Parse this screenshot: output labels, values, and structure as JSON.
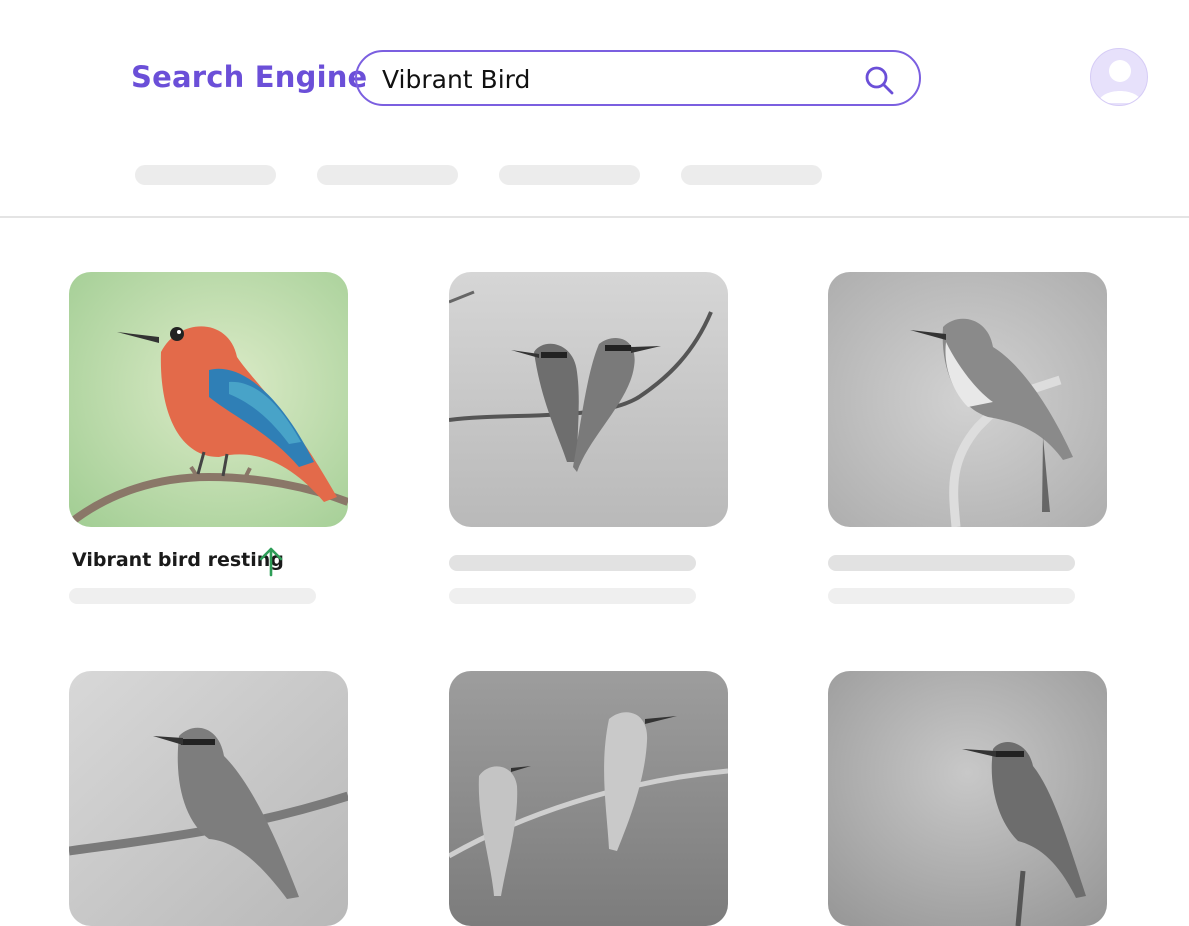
{
  "header": {
    "brand": "Search Engine",
    "search": {
      "value": "Vibrant Bird"
    }
  },
  "results": [
    {
      "caption": "Vibrant bird resting",
      "trend": "up",
      "color": "full"
    },
    {
      "color": "grayscale"
    },
    {
      "color": "grayscale"
    },
    {
      "color": "grayscale"
    },
    {
      "color": "grayscale"
    },
    {
      "color": "grayscale"
    }
  ],
  "icons": {
    "search": "search-icon",
    "avatar": "user-icon",
    "trend": "arrow-up-icon"
  },
  "colors": {
    "brand": "#6b4fd8",
    "search_border": "#7b5fe0",
    "trend": "#2e9e58",
    "skeleton": "#ececec"
  }
}
